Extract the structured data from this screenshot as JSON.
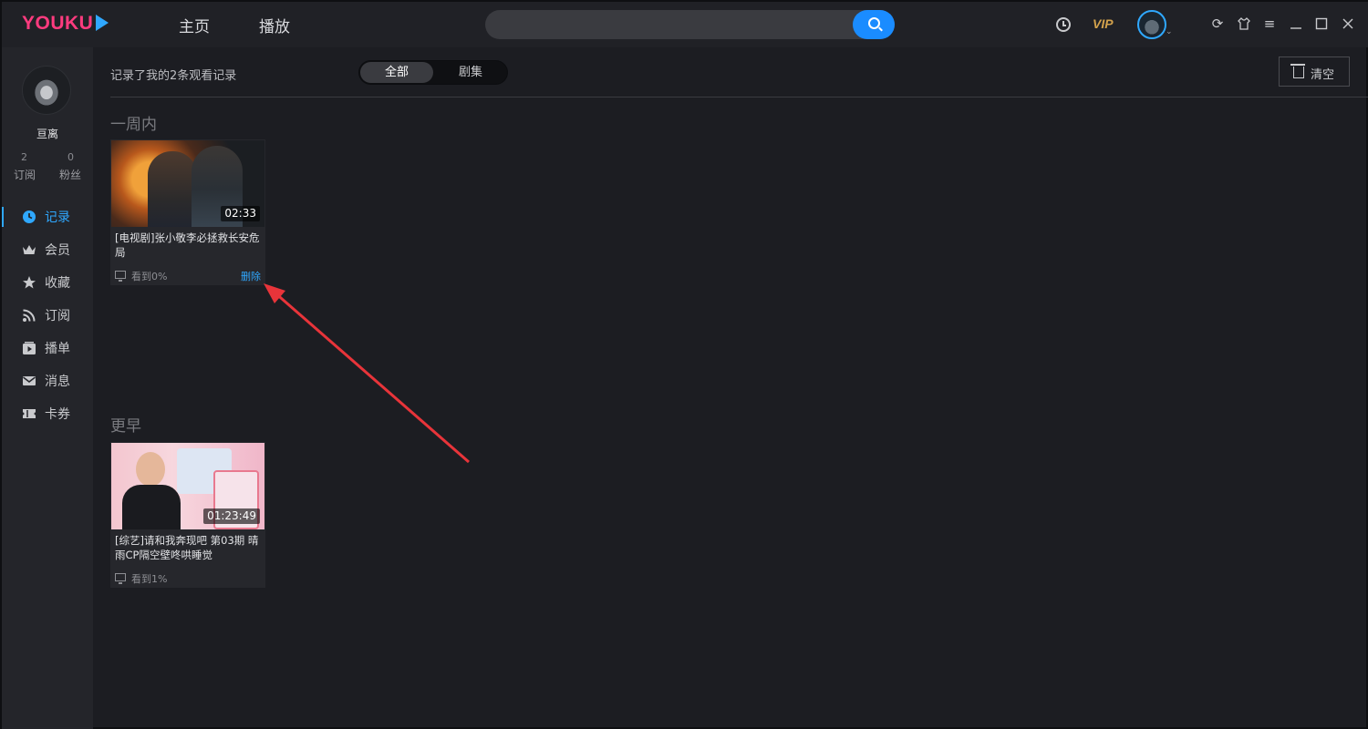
{
  "app": {
    "logo_text": "YOUKU"
  },
  "topbar": {
    "nav_home": "主页",
    "nav_play": "播放",
    "search": {
      "placeholder": ""
    },
    "vip_label": "VIP"
  },
  "sidebar": {
    "username": "亘离",
    "stats": [
      {
        "count": "2",
        "label": "订阅"
      },
      {
        "count": "0",
        "label": "粉丝"
      }
    ],
    "menu": [
      {
        "label": "记录",
        "icon": "clock-icon",
        "active": true
      },
      {
        "label": "会员",
        "icon": "crown-icon",
        "active": false
      },
      {
        "label": "收藏",
        "icon": "star-icon",
        "active": false
      },
      {
        "label": "订阅",
        "icon": "rss-icon",
        "active": false
      },
      {
        "label": "播单",
        "icon": "playlist-icon",
        "active": false
      },
      {
        "label": "消息",
        "icon": "mail-icon",
        "active": false
      },
      {
        "label": "卡券",
        "icon": "ticket-icon",
        "active": false
      }
    ]
  },
  "main": {
    "summary": "记录了我的2条观看记录",
    "filter_tabs": [
      "全部",
      "剧集"
    ],
    "clear_label": "清空",
    "sections": [
      {
        "title": "一周内",
        "items": [
          {
            "title": "[电视剧]张小敬李必拯救长安危局",
            "duration": "02:33",
            "progress": "看到0%",
            "delete_label": "删除"
          }
        ]
      },
      {
        "title": "更早",
        "items": [
          {
            "title": "[综艺]请和我奔现吧 第03期 晴雨CP隔空壁咚哄睡觉",
            "duration": "01:23:49",
            "progress": "看到1%"
          }
        ]
      }
    ]
  },
  "colors": {
    "accent": "#2fa8ff",
    "annotation_arrow": "#e8343a",
    "brand": "#ff3b7f"
  }
}
